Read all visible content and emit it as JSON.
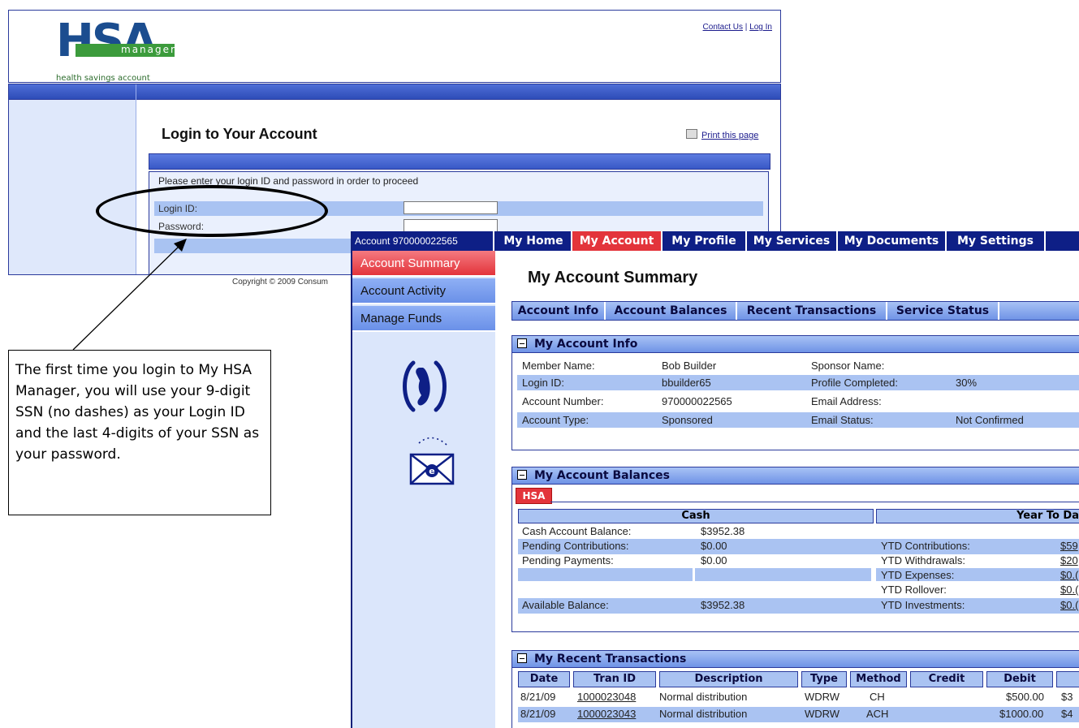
{
  "login_page": {
    "logo": {
      "letters": "HSA",
      "bar_text": "manager",
      "tagline": "health savings account"
    },
    "top_links": {
      "contact": "Contact Us",
      "separator": "|",
      "login": "Log In"
    },
    "title": "Login to Your Account",
    "print_link": "Print this page",
    "instructions": "Please enter your login ID and password in order to proceed",
    "login_id_label": "Login ID:",
    "password_label": "Password:",
    "login_id_value": "",
    "password_value": "",
    "copyright": "Copyright © 2009 Consum"
  },
  "callout": {
    "text": "The first time you login to My HSA Manager, you will use your 9-digit SSN (no dashes) as your Login ID and the last 4-digits of your SSN as your password."
  },
  "account_page": {
    "account_id": "Account 970000022565",
    "nav_tabs": [
      "My Home",
      "My Account",
      "My Profile",
      "My Services",
      "My Documents",
      "My Settings"
    ],
    "active_tab": "My Account",
    "side_menu": [
      "Account Summary",
      "Account Activity",
      "Manage Funds"
    ],
    "side_icons": [
      "phone-icon",
      "email-icon"
    ],
    "title": "My Account Summary",
    "sub_tabs": [
      "Account Info",
      "Account Balances",
      "Recent Transactions",
      "Service Status"
    ],
    "info": {
      "section_title": "My Account Info",
      "member_name_label": "Member Name:",
      "member_name": "Bob Builder",
      "sponsor_name_label": "Sponsor Name:",
      "sponsor_name": "",
      "login_id_label": "Login ID:",
      "login_id": "bbuilder65",
      "profile_completed_label": "Profile Completed:",
      "profile_completed": "30%",
      "account_number_label": "Account Number:",
      "account_number": "970000022565",
      "email_address_label": "Email Address:",
      "email_address": "",
      "account_type_label": "Account Type:",
      "account_type": "Sponsored",
      "email_status_label": "Email Status:",
      "email_status": "Not Confirmed"
    },
    "balances": {
      "section_title": "My Account Balances",
      "tab": "HSA",
      "cash_header": "Cash",
      "ytd_header": "Year To Da",
      "cash_balance_label": "Cash Account Balance:",
      "cash_balance": "$3952.38",
      "pending_contrib_label": "Pending Contributions:",
      "pending_contrib": "$0.00",
      "pending_payments_label": "Pending Payments:",
      "pending_payments": "$0.00",
      "available_balance_label": "Available Balance:",
      "available_balance": "$3952.38",
      "ytd_contrib_label": "YTD Contributions:",
      "ytd_contrib": "$59",
      "ytd_withdrawals_label": "YTD Withdrawals:",
      "ytd_withdrawals": "$20",
      "ytd_expenses_label": "YTD Expenses:",
      "ytd_expenses": "$0.(",
      "ytd_rollover_label": "YTD Rollover:",
      "ytd_rollover": "$0.(",
      "ytd_investments_label": "YTD Investments:",
      "ytd_investments": "$0.("
    },
    "transactions": {
      "section_title": "My Recent Transactions",
      "columns": [
        "Date",
        "Tran ID",
        "Description",
        "Type",
        "Method",
        "Credit",
        "Debit",
        ""
      ],
      "rows": [
        {
          "date": "8/21/09",
          "tran_id": "1000023048",
          "description": "Normal distribution",
          "type": "WDRW",
          "method": "CH",
          "credit": "",
          "debit": "$500.00",
          "balance": "$3"
        },
        {
          "date": "8/21/09",
          "tran_id": "1000023043",
          "description": "Normal distribution",
          "type": "WDRW",
          "method": "ACH",
          "credit": "",
          "debit": "$1000.00",
          "balance": "$4"
        }
      ]
    }
  }
}
